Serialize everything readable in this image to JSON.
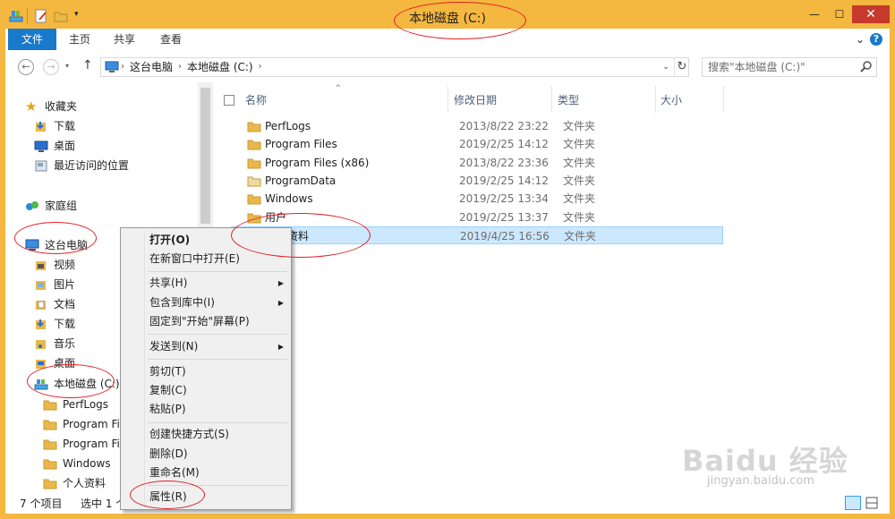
{
  "window": {
    "title": "本地磁盘 (C:)",
    "minimize_glyph": "—",
    "maximize_glyph": "☐",
    "close_glyph": "✕",
    "qat_dropdown_glyph": "▾"
  },
  "ribbon": {
    "tabs": [
      "文件",
      "主页",
      "共享",
      "查看"
    ],
    "expand_glyph": "⌄",
    "help_glyph": "?"
  },
  "address": {
    "crumbs": [
      "这台电脑",
      "本地磁盘 (C:)"
    ],
    "chevron": "›",
    "dropdown_glyph": "⌄",
    "refresh_glyph": "↻",
    "back_glyph": "←",
    "forward_glyph": "→",
    "up_glyph": "↑",
    "recent_glyph": "▾",
    "search_placeholder": "搜索\"本地磁盘 (C:)\""
  },
  "nav": {
    "favorites": "收藏夹",
    "fav_items": [
      "下载",
      "桌面",
      "最近访问的位置"
    ],
    "homegroup": "家庭组",
    "this_pc": "这台电脑",
    "pc_items": [
      "视频",
      "图片",
      "文档",
      "下载",
      "音乐",
      "桌面"
    ],
    "local_disk": "本地磁盘 (C:)",
    "disk_items": [
      "PerfLogs",
      "Program Fil",
      "Program Fil",
      "Windows",
      "个人资料"
    ]
  },
  "columns": {
    "name": "名称",
    "date": "修改日期",
    "type": "类型",
    "size": "大小",
    "sort_glyph": "^"
  },
  "files": [
    {
      "name": "PerfLogs",
      "date": "2013/8/22 23:22",
      "type": "文件夹"
    },
    {
      "name": "Program Files",
      "date": "2019/2/25 14:12",
      "type": "文件夹"
    },
    {
      "name": "Program Files (x86)",
      "date": "2013/8/22 23:36",
      "type": "文件夹"
    },
    {
      "name": "ProgramData",
      "date": "2019/2/25 14:12",
      "type": "文件夹"
    },
    {
      "name": "Windows",
      "date": "2019/2/25 13:34",
      "type": "文件夹"
    },
    {
      "name": "用户",
      "date": "2019/2/25 13:37",
      "type": "文件夹"
    },
    {
      "name": "个人资料",
      "date": "2019/4/25 16:56",
      "type": "文件夹"
    }
  ],
  "status": {
    "count": "7 个项目",
    "selected": "选中 1 个"
  },
  "context_menu": {
    "open": "打开(O)",
    "open_new_window": "在新窗口中打开(E)",
    "share": "共享(H)",
    "include_library": "包含到库中(I)",
    "pin_start": "固定到\"开始\"屏幕(P)",
    "send_to": "发送到(N)",
    "cut": "剪切(T)",
    "copy": "复制(C)",
    "paste": "粘贴(P)",
    "create_shortcut": "创建快捷方式(S)",
    "delete": "删除(D)",
    "rename": "重命名(M)",
    "properties": "属性(R)",
    "submenu_glyph": "▶"
  },
  "watermark": {
    "logo": "Baidu 经验",
    "url": "jingyan.baidu.com"
  },
  "colors": {
    "title_bar": "#f4b73f",
    "file_tab": "#1979ca",
    "close_button": "#c7392d",
    "selection": "#cce8ff",
    "annotation": "#e41e24",
    "folder": "#e8b84a"
  }
}
